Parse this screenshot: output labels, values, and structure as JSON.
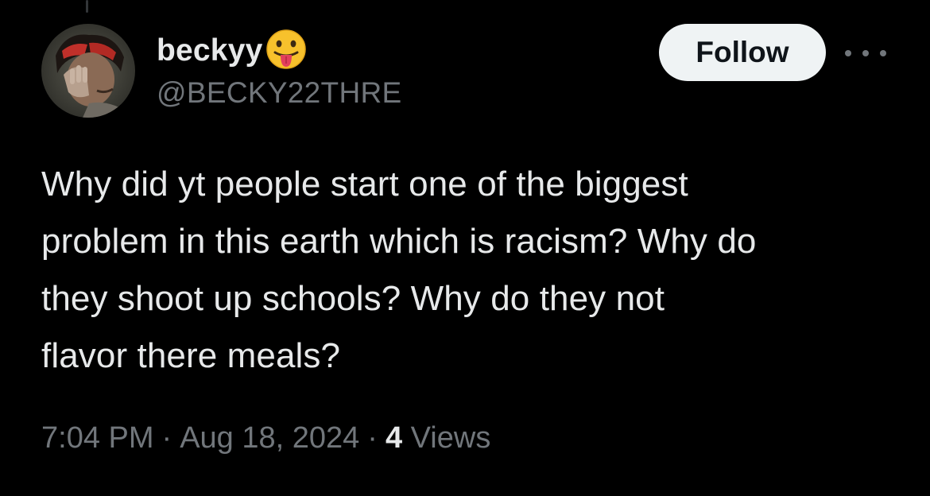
{
  "author": {
    "display_name": "beckyy",
    "handle": "@BECKY22THRE",
    "emoji_icon": "face-with-tongue-emoji"
  },
  "actions": {
    "follow_label": "Follow",
    "more_icon": "more-horizontal-icon"
  },
  "tweet": {
    "text_lines": [
      "Why did yt people start one of the biggest",
      "problem in this earth which is racism? Why do",
      "they shoot up schools? Why do they not",
      "flavor there meals?"
    ]
  },
  "meta": {
    "time": "7:04 PM",
    "separator": "·",
    "date": "Aug 18, 2024",
    "views_count": "4",
    "views_label": "Views"
  },
  "colors": {
    "background": "#000000",
    "primary_text": "#e7e9ea",
    "secondary_text": "#71767b",
    "follow_bg": "#eff3f4",
    "follow_text": "#0f1419"
  }
}
